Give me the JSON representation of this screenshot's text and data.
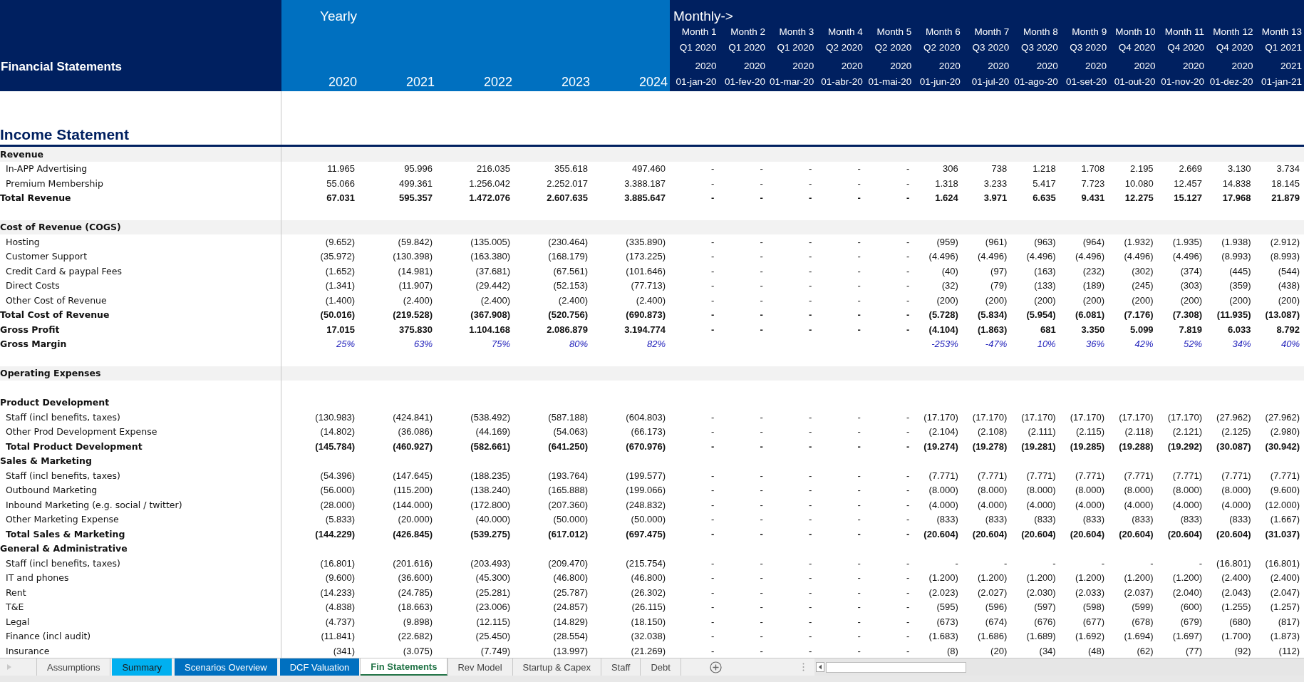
{
  "header": {
    "title": "Financial Statements",
    "yearly_label": "Yearly",
    "monthly_label": "Monthly->",
    "years": [
      "2020",
      "2021",
      "2022",
      "2023",
      "2024"
    ],
    "months": [
      {
        "month": "Month 1",
        "quarter": "Q1 2020",
        "year": "2020",
        "date": "01-jan-20"
      },
      {
        "month": "Month 2",
        "quarter": "Q1 2020",
        "year": "2020",
        "date": "01-fev-20"
      },
      {
        "month": "Month 3",
        "quarter": "Q1 2020",
        "year": "2020",
        "date": "01-mar-20"
      },
      {
        "month": "Month 4",
        "quarter": "Q2 2020",
        "year": "2020",
        "date": "01-abr-20"
      },
      {
        "month": "Month 5",
        "quarter": "Q2 2020",
        "year": "2020",
        "date": "01-mai-20"
      },
      {
        "month": "Month 6",
        "quarter": "Q2 2020",
        "year": "2020",
        "date": "01-jun-20"
      },
      {
        "month": "Month 7",
        "quarter": "Q3 2020",
        "year": "2020",
        "date": "01-jul-20"
      },
      {
        "month": "Month 8",
        "quarter": "Q3 2020",
        "year": "2020",
        "date": "01-ago-20"
      },
      {
        "month": "Month 9",
        "quarter": "Q3 2020",
        "year": "2020",
        "date": "01-set-20"
      },
      {
        "month": "Month 10",
        "quarter": "Q4 2020",
        "year": "2020",
        "date": "01-out-20"
      },
      {
        "month": "Month 11",
        "quarter": "Q4 2020",
        "year": "2020",
        "date": "01-nov-20"
      },
      {
        "month": "Month 12",
        "quarter": "Q4 2020",
        "year": "2020",
        "date": "01-dez-20"
      },
      {
        "month": "Month 13",
        "quarter": "Q1 2021",
        "year": "2021",
        "date": "01-jan-21"
      }
    ]
  },
  "section_title": "Income Statement",
  "rows": [
    {
      "kind": "band",
      "label": "Revenue"
    },
    {
      "kind": "item",
      "label": "In-APP Advertising",
      "yearly": [
        "11.965",
        "95.996",
        "216.035",
        "355.618",
        "497.460"
      ],
      "monthly": [
        "-",
        "-",
        "-",
        "-",
        "-",
        "306",
        "738",
        "1.218",
        "1.708",
        "2.195",
        "2.669",
        "3.130",
        "3.734"
      ]
    },
    {
      "kind": "item",
      "label": "Premium Membership",
      "yearly": [
        "55.066",
        "499.361",
        "1.256.042",
        "2.252.017",
        "3.388.187"
      ],
      "monthly": [
        "-",
        "-",
        "-",
        "-",
        "-",
        "1.318",
        "3.233",
        "5.417",
        "7.723",
        "10.080",
        "12.457",
        "14.838",
        "18.145"
      ]
    },
    {
      "kind": "total",
      "label": "Total Revenue",
      "yearly": [
        "67.031",
        "595.357",
        "1.472.076",
        "2.607.635",
        "3.885.647"
      ],
      "monthly": [
        "-",
        "-",
        "-",
        "-",
        "-",
        "1.624",
        "3.971",
        "6.635",
        "9.431",
        "12.275",
        "15.127",
        "17.968",
        "21.879"
      ]
    },
    {
      "kind": "blank"
    },
    {
      "kind": "band",
      "label": "Cost of Revenue (COGS)"
    },
    {
      "kind": "item",
      "label": "Hosting",
      "yearly": [
        "(9.652)",
        "(59.842)",
        "(135.005)",
        "(230.464)",
        "(335.890)"
      ],
      "monthly": [
        "-",
        "-",
        "-",
        "-",
        "-",
        "(959)",
        "(961)",
        "(963)",
        "(964)",
        "(1.932)",
        "(1.935)",
        "(1.938)",
        "(2.912)"
      ]
    },
    {
      "kind": "item",
      "label": "Customer Support",
      "yearly": [
        "(35.972)",
        "(130.398)",
        "(163.380)",
        "(168.179)",
        "(173.225)"
      ],
      "monthly": [
        "-",
        "-",
        "-",
        "-",
        "-",
        "(4.496)",
        "(4.496)",
        "(4.496)",
        "(4.496)",
        "(4.496)",
        "(4.496)",
        "(8.993)",
        "(8.993)"
      ]
    },
    {
      "kind": "item",
      "label": "Credit Card & paypal Fees",
      "yearly": [
        "(1.652)",
        "(14.981)",
        "(37.681)",
        "(67.561)",
        "(101.646)"
      ],
      "monthly": [
        "-",
        "-",
        "-",
        "-",
        "-",
        "(40)",
        "(97)",
        "(163)",
        "(232)",
        "(302)",
        "(374)",
        "(445)",
        "(544)"
      ]
    },
    {
      "kind": "item",
      "label": "Direct Costs",
      "yearly": [
        "(1.341)",
        "(11.907)",
        "(29.442)",
        "(52.153)",
        "(77.713)"
      ],
      "monthly": [
        "-",
        "-",
        "-",
        "-",
        "-",
        "(32)",
        "(79)",
        "(133)",
        "(189)",
        "(245)",
        "(303)",
        "(359)",
        "(438)"
      ]
    },
    {
      "kind": "item",
      "label": "Other Cost of Revenue",
      "yearly": [
        "(1.400)",
        "(2.400)",
        "(2.400)",
        "(2.400)",
        "(2.400)"
      ],
      "monthly": [
        "-",
        "-",
        "-",
        "-",
        "-",
        "(200)",
        "(200)",
        "(200)",
        "(200)",
        "(200)",
        "(200)",
        "(200)",
        "(200)"
      ]
    },
    {
      "kind": "total",
      "label": "Total Cost of Revenue",
      "yearly": [
        "(50.016)",
        "(219.528)",
        "(367.908)",
        "(520.756)",
        "(690.873)"
      ],
      "monthly": [
        "-",
        "-",
        "-",
        "-",
        "-",
        "(5.728)",
        "(5.834)",
        "(5.954)",
        "(6.081)",
        "(7.176)",
        "(7.308)",
        "(11.935)",
        "(13.087)"
      ]
    },
    {
      "kind": "total",
      "label": "Gross Profit",
      "yearly": [
        "17.015",
        "375.830",
        "1.104.168",
        "2.086.879",
        "3.194.774"
      ],
      "monthly": [
        "-",
        "-",
        "-",
        "-",
        "-",
        "(4.104)",
        "(1.863)",
        "681",
        "3.350",
        "5.099",
        "7.819",
        "6.033",
        "8.792"
      ]
    },
    {
      "kind": "percent",
      "label": "Gross Margin",
      "yearly": [
        "25%",
        "63%",
        "75%",
        "80%",
        "82%"
      ],
      "monthly": [
        "-253%",
        "-47%",
        "10%",
        "36%",
        "42%",
        "52%",
        "34%",
        "40%"
      ]
    },
    {
      "kind": "blank"
    },
    {
      "kind": "band",
      "label": "Operating Expenses"
    },
    {
      "kind": "blank"
    },
    {
      "kind": "heading",
      "label": "Product Development"
    },
    {
      "kind": "item",
      "label": "Staff (incl benefits, taxes)",
      "yearly": [
        "(130.983)",
        "(424.841)",
        "(538.492)",
        "(587.188)",
        "(604.803)"
      ],
      "monthly": [
        "-",
        "-",
        "-",
        "-",
        "-",
        "(17.170)",
        "(17.170)",
        "(17.170)",
        "(17.170)",
        "(17.170)",
        "(17.170)",
        "(27.962)",
        "(27.962)"
      ]
    },
    {
      "kind": "item",
      "label": "Other Prod Development Expense",
      "yearly": [
        "(14.802)",
        "(36.086)",
        "(44.169)",
        "(54.063)",
        "(66.173)"
      ],
      "monthly": [
        "-",
        "-",
        "-",
        "-",
        "-",
        "(2.104)",
        "(2.108)",
        "(2.111)",
        "(2.115)",
        "(2.118)",
        "(2.121)",
        "(2.125)",
        "(2.980)"
      ]
    },
    {
      "kind": "subtotal",
      "label": "Total Product Development",
      "yearly": [
        "(145.784)",
        "(460.927)",
        "(582.661)",
        "(641.250)",
        "(670.976)"
      ],
      "monthly": [
        "-",
        "-",
        "-",
        "-",
        "-",
        "(19.274)",
        "(19.278)",
        "(19.281)",
        "(19.285)",
        "(19.288)",
        "(19.292)",
        "(30.087)",
        "(30.942)"
      ]
    },
    {
      "kind": "heading",
      "label": "Sales & Marketing"
    },
    {
      "kind": "item",
      "label": "Staff (incl benefits, taxes)",
      "yearly": [
        "(54.396)",
        "(147.645)",
        "(188.235)",
        "(193.764)",
        "(199.577)"
      ],
      "monthly": [
        "-",
        "-",
        "-",
        "-",
        "-",
        "(7.771)",
        "(7.771)",
        "(7.771)",
        "(7.771)",
        "(7.771)",
        "(7.771)",
        "(7.771)",
        "(7.771)"
      ]
    },
    {
      "kind": "item",
      "label": "Outbound Marketing",
      "yearly": [
        "(56.000)",
        "(115.200)",
        "(138.240)",
        "(165.888)",
        "(199.066)"
      ],
      "monthly": [
        "-",
        "-",
        "-",
        "-",
        "-",
        "(8.000)",
        "(8.000)",
        "(8.000)",
        "(8.000)",
        "(8.000)",
        "(8.000)",
        "(8.000)",
        "(9.600)"
      ]
    },
    {
      "kind": "item",
      "label": "Inbound Marketing (e.g. social / twitter)",
      "yearly": [
        "(28.000)",
        "(144.000)",
        "(172.800)",
        "(207.360)",
        "(248.832)"
      ],
      "monthly": [
        "-",
        "-",
        "-",
        "-",
        "-",
        "(4.000)",
        "(4.000)",
        "(4.000)",
        "(4.000)",
        "(4.000)",
        "(4.000)",
        "(4.000)",
        "(12.000)"
      ]
    },
    {
      "kind": "item",
      "label": "Other Marketing Expense",
      "yearly": [
        "(5.833)",
        "(20.000)",
        "(40.000)",
        "(50.000)",
        "(50.000)"
      ],
      "monthly": [
        "-",
        "-",
        "-",
        "-",
        "-",
        "(833)",
        "(833)",
        "(833)",
        "(833)",
        "(833)",
        "(833)",
        "(833)",
        "(1.667)"
      ]
    },
    {
      "kind": "subtotal",
      "label": "Total Sales & Marketing",
      "yearly": [
        "(144.229)",
        "(426.845)",
        "(539.275)",
        "(617.012)",
        "(697.475)"
      ],
      "monthly": [
        "-",
        "-",
        "-",
        "-",
        "-",
        "(20.604)",
        "(20.604)",
        "(20.604)",
        "(20.604)",
        "(20.604)",
        "(20.604)",
        "(20.604)",
        "(31.037)"
      ]
    },
    {
      "kind": "heading",
      "label": "General & Administrative"
    },
    {
      "kind": "item",
      "label": "Staff (incl benefits, taxes)",
      "yearly": [
        "(16.801)",
        "(201.616)",
        "(203.493)",
        "(209.470)",
        "(215.754)"
      ],
      "monthly": [
        "-",
        "-",
        "-",
        "-",
        "-",
        "-",
        "-",
        "-",
        "-",
        "-",
        "-",
        "(16.801)",
        "(16.801)"
      ]
    },
    {
      "kind": "item",
      "label": "IT and phones",
      "yearly": [
        "(9.600)",
        "(36.600)",
        "(45.300)",
        "(46.800)",
        "(46.800)"
      ],
      "monthly": [
        "-",
        "-",
        "-",
        "-",
        "-",
        "(1.200)",
        "(1.200)",
        "(1.200)",
        "(1.200)",
        "(1.200)",
        "(1.200)",
        "(2.400)",
        "(2.400)"
      ]
    },
    {
      "kind": "item",
      "label": "Rent",
      "yearly": [
        "(14.233)",
        "(24.785)",
        "(25.281)",
        "(25.787)",
        "(26.302)"
      ],
      "monthly": [
        "-",
        "-",
        "-",
        "-",
        "-",
        "(2.023)",
        "(2.027)",
        "(2.030)",
        "(2.033)",
        "(2.037)",
        "(2.040)",
        "(2.043)",
        "(2.047)"
      ]
    },
    {
      "kind": "item",
      "label": "T&E",
      "yearly": [
        "(4.838)",
        "(18.663)",
        "(23.006)",
        "(24.857)",
        "(26.115)"
      ],
      "monthly": [
        "-",
        "-",
        "-",
        "-",
        "-",
        "(595)",
        "(596)",
        "(597)",
        "(598)",
        "(599)",
        "(600)",
        "(1.255)",
        "(1.257)"
      ]
    },
    {
      "kind": "item",
      "label": "Legal",
      "yearly": [
        "(4.737)",
        "(9.898)",
        "(12.115)",
        "(14.829)",
        "(18.150)"
      ],
      "monthly": [
        "-",
        "-",
        "-",
        "-",
        "-",
        "(673)",
        "(674)",
        "(676)",
        "(677)",
        "(678)",
        "(679)",
        "(680)",
        "(817)"
      ]
    },
    {
      "kind": "item",
      "label": "Finance (incl audit)",
      "yearly": [
        "(11.841)",
        "(22.682)",
        "(25.450)",
        "(28.554)",
        "(32.038)"
      ],
      "monthly": [
        "-",
        "-",
        "-",
        "-",
        "-",
        "(1.683)",
        "(1.686)",
        "(1.689)",
        "(1.692)",
        "(1.694)",
        "(1.697)",
        "(1.700)",
        "(1.873)"
      ]
    },
    {
      "kind": "item",
      "label": "Insurance",
      "yearly": [
        "(341)",
        "(3.075)",
        "(7.749)",
        "(13.997)",
        "(21.269)"
      ],
      "monthly": [
        "-",
        "-",
        "-",
        "-",
        "-",
        "(8)",
        "(20)",
        "(34)",
        "(48)",
        "(62)",
        "(77)",
        "(92)",
        "(112)"
      ]
    }
  ],
  "tabs": [
    {
      "label": "Assumptions",
      "selected": false
    },
    {
      "label": "Summary",
      "selected": false,
      "color": "#00b0f0"
    },
    {
      "label": "Scenarios Overview",
      "selected": false,
      "color": "#0070c0"
    },
    {
      "label": "DCF Valuation",
      "selected": false,
      "color": "#0070c0"
    },
    {
      "label": "Fin Statements",
      "selected": true
    },
    {
      "label": "Rev Model",
      "selected": false
    },
    {
      "label": "Startup & Capex",
      "selected": false
    },
    {
      "label": "Staff",
      "selected": false
    },
    {
      "label": "Debt",
      "selected": false
    }
  ]
}
